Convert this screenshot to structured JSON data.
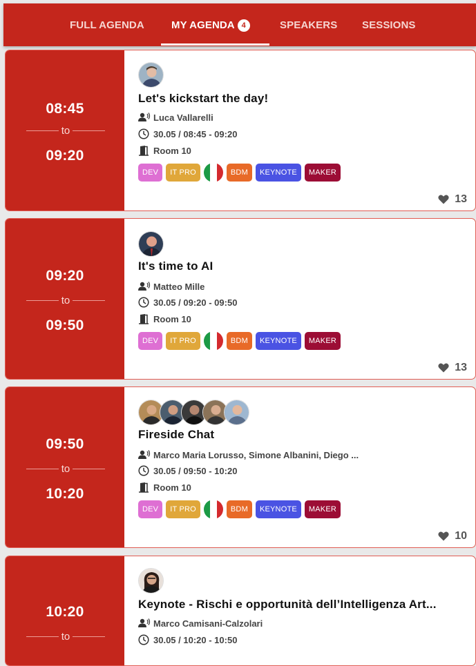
{
  "nav": {
    "tabs": [
      {
        "label": "FULL AGENDA"
      },
      {
        "label": "MY AGENDA",
        "badge": "4",
        "active": true
      },
      {
        "label": "SPEAKERS"
      },
      {
        "label": "SESSIONS"
      }
    ]
  },
  "colors": {
    "brand_red": "#c4261c",
    "tag_dev": "#de6fd3",
    "tag_itpro": "#e0a73a",
    "tag_bdm": "#e86a28",
    "tag_keynote": "#4a53e3",
    "tag_maker": "#9c0d35"
  },
  "tags": [
    "DEV",
    "IT PRO",
    "BDM",
    "KEYNOTE",
    "MAKER"
  ],
  "flag_name": "italy-flag-icon",
  "sessions": [
    {
      "start": "08:45",
      "to": "to",
      "end": "09:20",
      "title": "Let's kickstart the day!",
      "speakers": "Luca Vallarelli",
      "datetime": "30.05 / 08:45 - 09:20",
      "room": "Room 10",
      "likes": "13"
    },
    {
      "start": "09:20",
      "to": "to",
      "end": "09:50",
      "title": "It's time to AI",
      "speakers": "Matteo Mille",
      "datetime": "30.05 / 09:20 - 09:50",
      "room": "Room 10",
      "likes": "13"
    },
    {
      "start": "09:50",
      "to": "to",
      "end": "10:20",
      "title": "Fireside Chat",
      "speakers": "Marco Maria Lorusso, Simone Albanini, Diego ...",
      "datetime": "30.05 / 09:50 - 10:20",
      "room": "Room 10",
      "likes": "10"
    },
    {
      "start": "10:20",
      "to": "to",
      "end": "",
      "title": "Keynote - Rischi e opportunità dell’Intelligenza Art...",
      "speakers": "Marco Camisani-Calzolari",
      "datetime": "30.05 / 10:20 - 10:50",
      "room": "",
      "likes": ""
    }
  ]
}
